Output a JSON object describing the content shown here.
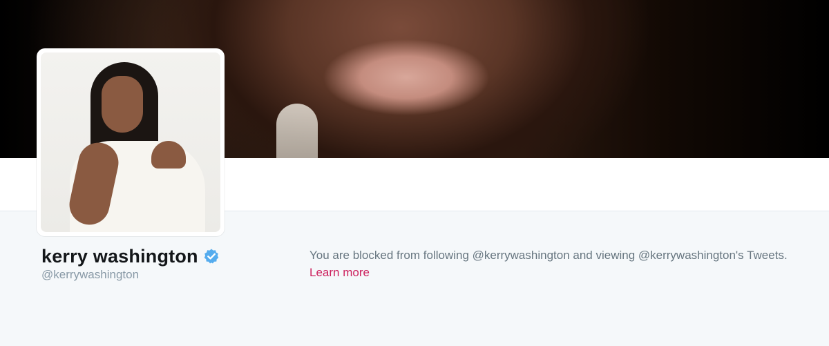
{
  "profile": {
    "name": "kerry washington",
    "screen_name": "@kerrywashington",
    "verified_icon": "verified-badge-icon"
  },
  "blocked_notice": {
    "message": "You are blocked from following @kerrywashington and viewing @kerrywashington's Tweets.",
    "learn_more_label": "Learn more"
  },
  "colors": {
    "page_background": "#f5f8fa",
    "verified_blue": "#55acee",
    "link_color": "#cc1f5c",
    "name_color": "#14171a",
    "muted_text": "#8899a6"
  }
}
